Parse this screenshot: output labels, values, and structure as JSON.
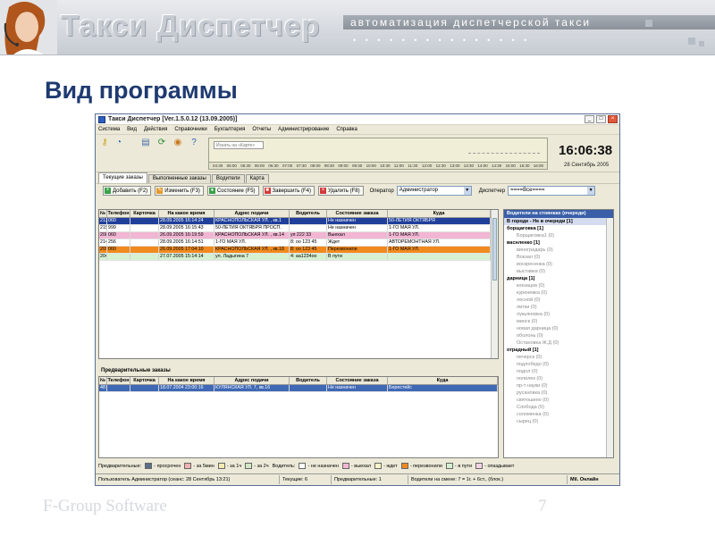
{
  "slide": {
    "brand_title": "Такси Диспетчер",
    "brand_subtitle": "автоматизация диспетчерской такси",
    "title": "Вид программы",
    "footer": "F-Group Software",
    "page_number": "7"
  },
  "window": {
    "title": "Такси Диспетчер [Ver.1.5.0.12  (13.09.2005)]",
    "menu": [
      "Система",
      "Вид",
      "Действия",
      "Справочники",
      "Бухгалтерия",
      "Отчеты",
      "Администрирование",
      "Справка"
    ],
    "toolbar_icons": [
      "keys-icon",
      "clock-icon",
      "document-icon",
      "refresh-icon",
      "globe-icon",
      "help-icon"
    ],
    "timeline": {
      "search_text": "Искать на «Карте»",
      "ticks": [
        "04:30",
        "05:00",
        "05:30",
        "06:00",
        "06:30",
        "07:00",
        "07:30",
        "08:00",
        "08:30",
        "09:00",
        "09:30",
        "10:00",
        "10:30",
        "11:00",
        "11:30",
        "12:00",
        "12:30",
        "13:00",
        "13:30",
        "14:00",
        "14:30",
        "15:00",
        "15:30",
        "16:00"
      ]
    },
    "clock_time": "16:06:38",
    "clock_date": "28 Сентябрь 2005",
    "tabs": [
      "Текущие заказы",
      "Выполненные заказы",
      "Водители",
      "Карта"
    ],
    "actions": [
      {
        "label": "Добавить (F2)",
        "color": "#3aa14a",
        "glyph": "+"
      },
      {
        "label": "Изменить (F3)",
        "color": "#e39a2b",
        "glyph": "✎"
      },
      {
        "label": "Состояние (F5)",
        "color": "#3aa14a",
        "glyph": "●"
      },
      {
        "label": "Завершить (F4)",
        "color": "#d23b3b",
        "glyph": "■"
      },
      {
        "label": "Удалить (F8)",
        "color": "#d23b3b",
        "glyph": "×"
      }
    ],
    "operator_label": "Оператор",
    "operator_value": "Администратор",
    "dispatcher_label": "Диспетчер",
    "dispatcher_value": "====Все===="
  },
  "orders": {
    "columns": [
      "№",
      "Телефон",
      "Карточка",
      "На какое время",
      "Адрес подачи",
      "Водитель",
      "Состояние заказа",
      "Куда"
    ],
    "rows": [
      {
        "cells": [
          "213",
          "060",
          "",
          "28.09.2005 16:14:24",
          "КРАСНОПОЛЬСКАЯ УЛ. , кв.1",
          "",
          "Не назначен",
          "50-ЛЕТИЯ ОКТЯБРЯ"
        ],
        "bg": "#1f3f9a",
        "fg": "#ffffff"
      },
      {
        "cells": [
          "215",
          "999",
          "",
          "28.09.2005 16:15:43",
          "50-ЛЕТИЯ ОКТЯБРЯ ПРОСП.",
          "",
          "Не назначен",
          "1-ГО МАЯ УЛ."
        ],
        "bg": "#ffffff",
        "fg": "#000000"
      },
      {
        "cells": [
          "208",
          "060",
          "",
          "26.09.2005 16:19:59",
          "КРАСНОПОЛЬСКАЯ УЛ. , кв.14",
          "уя 222 33",
          "Выехал",
          "1-ГО МАЯ УЛ."
        ],
        "bg": "#f1b6d3",
        "fg": "#000000"
      },
      {
        "cells": [
          "214",
          "256",
          "",
          "28.09.2005 16:14:51",
          "1-ГО МАЯ УЛ.",
          "8: оо 123 45",
          "Ждет",
          "АВТОРЕМОНТНАЯ УЛ."
        ],
        "bg": "#ffffff",
        "fg": "#000000"
      },
      {
        "cells": [
          "209",
          "060",
          "",
          "26.09.2005 17:04:10",
          "КРАСНОПОЛЬСКАЯ УЛ. , кв.18",
          "8: оо 123 45",
          "Перезвонили",
          "1-ГО МАЯ УЛ."
        ],
        "bg": "#f08a1e",
        "fg": "#000000"
      },
      {
        "cells": [
          "204",
          "",
          "",
          "27.07.2005 15:14:14",
          "ул. Ладыгина 7",
          "4: аа1234оо",
          "В пути",
          ""
        ],
        "bg": "#d6f0d2",
        "fg": "#000000"
      }
    ]
  },
  "preliminary": {
    "label": "Предварительные заказы",
    "columns": [
      "№",
      "Телефон",
      "Карточка",
      "На какое время",
      "Адрес подачи",
      "Водитель",
      "Состояние заказа",
      "Куда"
    ],
    "rows": [
      {
        "cells": [
          "48",
          "",
          "",
          "18.07.2004 23:00:16",
          "КУЛЯНСКАЯ УЛ. 7, кв.16",
          "",
          "Не назначен",
          "Берестейс"
        ],
        "bg": "#3f68b5",
        "fg": "#ffffff"
      }
    ]
  },
  "drivers": {
    "title": "Водители на стоянках (очереди)",
    "items": [
      {
        "text": "В городе - Не в очереди [1]",
        "type": "selected"
      },
      {
        "text": "борщаговка [1]",
        "type": "hdr"
      },
      {
        "text": "Борщаговка1 (0)",
        "type": "sub"
      },
      {
        "text": "васнленко [1]",
        "type": "hdr"
      },
      {
        "text": "виноградарь (0)",
        "type": "sub"
      },
      {
        "text": "Вокзал (0)",
        "type": "sub"
      },
      {
        "text": "воскресенка (0)",
        "type": "sub"
      },
      {
        "text": "выставка (0)",
        "type": "sub"
      },
      {
        "text": "дарница [1]",
        "type": "hdr"
      },
      {
        "text": "кнезацов (0)",
        "type": "sub"
      },
      {
        "text": "куреневка (0)",
        "type": "sub"
      },
      {
        "text": "лесной (0)",
        "type": "sub"
      },
      {
        "text": "литки (0)",
        "type": "sub"
      },
      {
        "text": "лукьяновка (0)",
        "type": "sub"
      },
      {
        "text": "минск (0)",
        "type": "sub"
      },
      {
        "text": "новая дарница (0)",
        "type": "sub"
      },
      {
        "text": "оболонь (0)",
        "type": "sub"
      },
      {
        "text": "Остановка Ж.Д (0)",
        "type": "sub"
      },
      {
        "text": "отрадный [1]",
        "type": "hdr"
      },
      {
        "text": "печерск (0)",
        "type": "sub"
      },
      {
        "text": "подлобедо (0)",
        "type": "sub"
      },
      {
        "text": "подол (0)",
        "type": "sub"
      },
      {
        "text": "полилек (0)",
        "type": "sub"
      },
      {
        "text": "пр-т науки (0)",
        "type": "sub"
      },
      {
        "text": "русановка (0)",
        "type": "sub"
      },
      {
        "text": "святошино (0)",
        "type": "sub"
      },
      {
        "text": "Слобода (0)",
        "type": "sub"
      },
      {
        "text": "соломенка (0)",
        "type": "sub"
      },
      {
        "text": "сырец (0)",
        "type": "sub"
      }
    ]
  },
  "legend": {
    "label_prelim": "Предварительные:",
    "label_driver": "Водитель:",
    "items": [
      {
        "color": "#5b6f86",
        "text": "- просрочен"
      },
      {
        "color": "#f2b2b2",
        "text": "- за 5мин"
      },
      {
        "color": "#f2ecb0",
        "text": "- за 1ч"
      },
      {
        "color": "#cfe8c6",
        "text": "- за 2ч"
      },
      {
        "color": "#ffffff",
        "text": "- не назначен"
      },
      {
        "color": "#f1b6d3",
        "text": "- выехал"
      },
      {
        "color": "#fbf6c8",
        "text": "- ждет"
      },
      {
        "color": "#f08a1e",
        "text": "- перезвонили"
      },
      {
        "color": "#d6f0d2",
        "text": "- в пути"
      },
      {
        "color": "#f6d3e4",
        "text": "- опаздывает"
      }
    ]
  },
  "status": {
    "user": "Пользователь Администратор  (сеанс: 28 Сентябрь  13:21)",
    "current": "Текущие: 6",
    "prelim": "Предварительные: 1",
    "shift": "Водители на смене: 7 = 1г. + 6ст., (блок.)",
    "online": "Mil. Онлайн"
  }
}
